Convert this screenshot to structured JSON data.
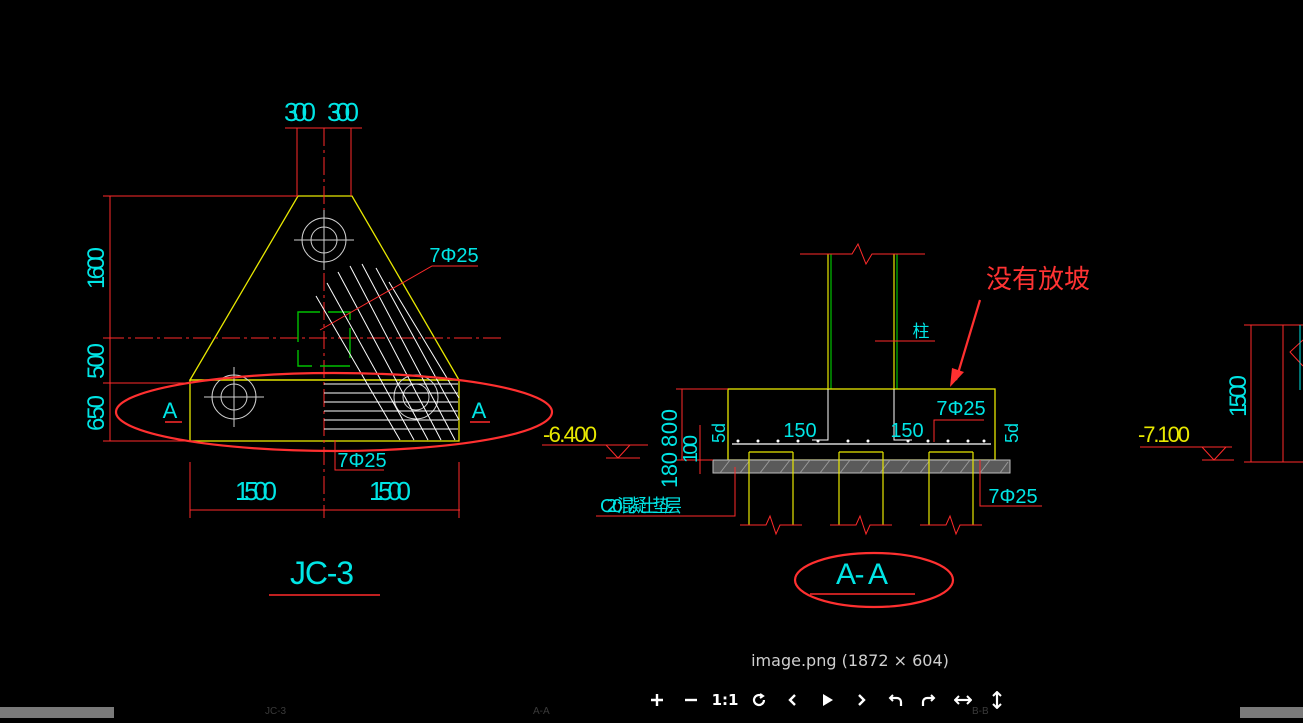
{
  "drawing": {
    "dims": {
      "top_left": "300",
      "top_right": "300",
      "left_1600": "1600",
      "left_500": "500",
      "left_650": "650",
      "bottom_left": "1500",
      "bottom_right": "1500",
      "aa_800": "800",
      "aa_100": "100",
      "aa_180": "180",
      "aa_150_left": "150",
      "aa_150_right": "150",
      "aa_5d_left": "5d",
      "aa_5d_right": "5d",
      "right_1500": "1500"
    },
    "rebar": {
      "plan_top": "7Φ25",
      "plan_bottom": "7Φ25",
      "aa_top": "7Φ25",
      "aa_bottom": "7Φ25"
    },
    "section_marks": {
      "left": "A",
      "right": "A"
    },
    "elevations": {
      "left": "-6.400",
      "right": "-7.100"
    },
    "labels": {
      "column": "柱",
      "cushion": "C20混凝土垫层"
    },
    "titles": {
      "plan": "JC-3",
      "section": "A- A"
    },
    "annotation": "没有放坡"
  },
  "viewer": {
    "caption": "image.png (1872 × 604)",
    "toolbar": [
      {
        "name": "zoom-in-button",
        "icon": "plus-icon",
        "glyph": "+"
      },
      {
        "name": "zoom-out-button",
        "icon": "minus-icon",
        "glyph": "−"
      },
      {
        "name": "actual-size-button",
        "icon": "one-to-one-icon",
        "glyph": "1:1"
      },
      {
        "name": "reset-button",
        "icon": "refresh-icon",
        "glyph": "↻"
      },
      {
        "name": "prev-button",
        "icon": "chevron-left-icon",
        "glyph": "‹"
      },
      {
        "name": "play-button",
        "icon": "play-icon",
        "glyph": "▶"
      },
      {
        "name": "next-button",
        "icon": "chevron-right-icon",
        "glyph": "›"
      },
      {
        "name": "rotate-left-button",
        "icon": "rotate-left-icon",
        "glyph": "↶"
      },
      {
        "name": "rotate-right-button",
        "icon": "rotate-right-icon",
        "glyph": "↷"
      },
      {
        "name": "flip-horizontal-button",
        "icon": "flip-horizontal-icon",
        "glyph": "↔"
      },
      {
        "name": "flip-vertical-button",
        "icon": "flip-vertical-icon",
        "glyph": "↕"
      }
    ],
    "thumb_labels": {
      "a": "JC-3",
      "b": "A-A",
      "c": "B-B"
    }
  },
  "colors": {
    "background": "#000000",
    "dim_line": "#ff0000",
    "dim_text": "#00e5e5",
    "outline": "#e8e800",
    "rebar": "#ffffff",
    "annotation": "#ff3333",
    "column_green": "#00c000"
  }
}
